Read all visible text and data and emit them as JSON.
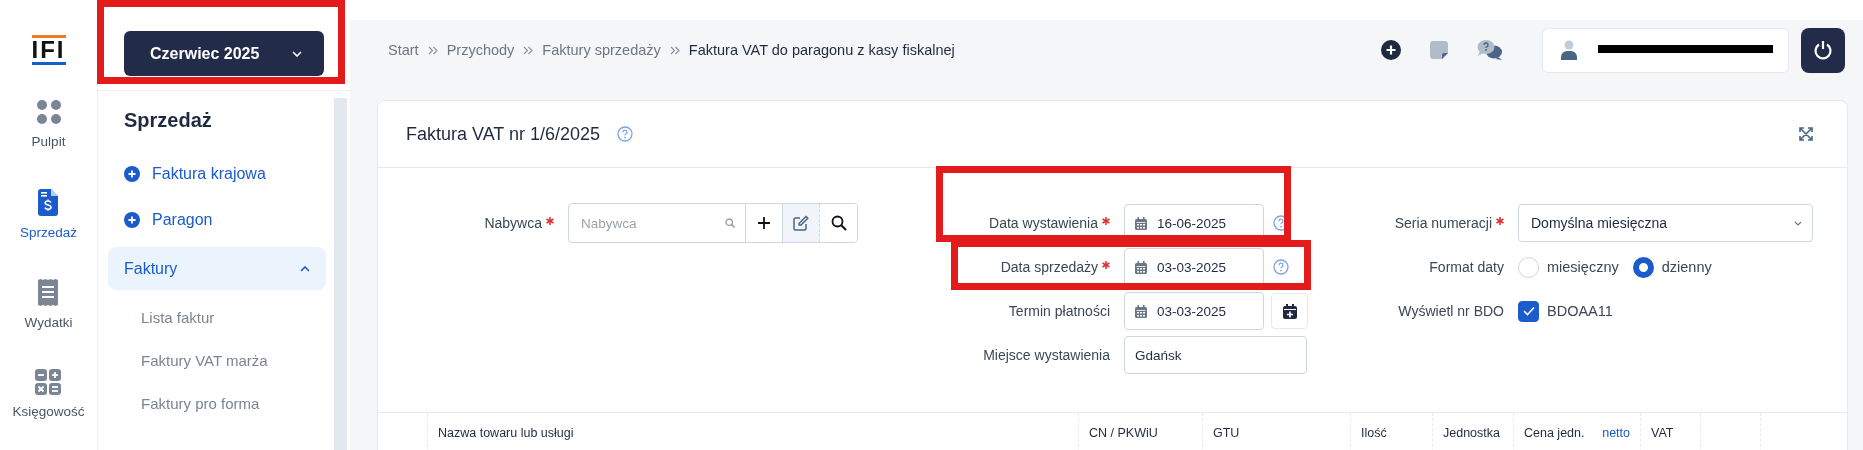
{
  "rail": {
    "logo": "IFI",
    "items": [
      {
        "label": "Pulpit",
        "selected": false
      },
      {
        "label": "Sprzedaż",
        "selected": true
      },
      {
        "label": "Wydatki",
        "selected": false
      },
      {
        "label": "Księgowość",
        "selected": false
      }
    ]
  },
  "period": {
    "label": "Czerwiec 2025",
    "highlighted": true
  },
  "sidebar": {
    "title": "Sprzedaż",
    "items": [
      {
        "kind": "action",
        "label": "Faktura krajowa"
      },
      {
        "kind": "action",
        "label": "Paragon"
      },
      {
        "kind": "group",
        "label": "Faktury",
        "expanded": true,
        "children": [
          {
            "label": "Lista faktur"
          },
          {
            "label": "Faktury VAT marża"
          },
          {
            "label": "Faktury pro forma"
          }
        ]
      }
    ]
  },
  "breadcrumb": [
    {
      "label": "Start"
    },
    {
      "label": "Przychody"
    },
    {
      "label": "Faktury sprzedaży"
    },
    {
      "label": "Faktura VAT do paragonu z kasy fiskalnej"
    }
  ],
  "user": {
    "redacted": true
  },
  "card": {
    "title": "Faktura VAT nr 1/6/2025"
  },
  "form": {
    "buyer": {
      "label": "Nabywca",
      "required": true,
      "placeholder": "Nabywca"
    },
    "dates": [
      {
        "kind": "help",
        "label": "Data wystawienia",
        "required": true,
        "value": "16-06-2025",
        "highlighted": true
      },
      {
        "kind": "help",
        "label": "Data sprzedaży",
        "required": true,
        "value": "03-03-2025",
        "highlighted": true
      },
      {
        "kind": "calendar",
        "label": "Termin płatności",
        "required": false,
        "value": "03-03-2025",
        "highlighted": false
      },
      {
        "kind": "text",
        "label": "Miejsce wystawienia",
        "required": false,
        "value": "Gdańsk",
        "highlighted": false
      }
    ],
    "series": {
      "label": "Seria numeracji",
      "required": true,
      "value": "Domyślna miesięczna"
    },
    "date_format": {
      "label": "Format daty",
      "options": [
        {
          "label": "miesięczny",
          "selected": false
        },
        {
          "label": "dzienny",
          "selected": true
        }
      ]
    },
    "bdo": {
      "label": "Wyświetl nr BDO",
      "checked": true,
      "value": "BDOAA11"
    }
  },
  "table": {
    "columns": [
      {
        "label": "Nazwa towaru lub usługi"
      },
      {
        "label": "CN / PKWiU"
      },
      {
        "label": "GTU"
      },
      {
        "label": "Ilość"
      },
      {
        "label": "Jednostka"
      },
      {
        "label": "Cena jedn.",
        "link": "netto"
      },
      {
        "label": "VAT"
      }
    ]
  }
}
